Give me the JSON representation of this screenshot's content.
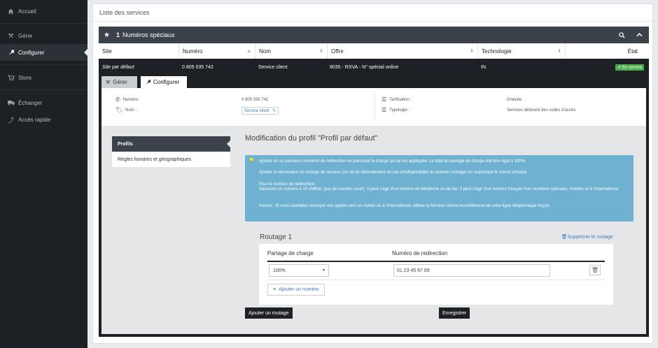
{
  "sidebar": {
    "items": [
      {
        "label": "Accueil",
        "icon": "home-icon"
      },
      {
        "label": "Gérer",
        "icon": "tools-icon"
      },
      {
        "label": "Configurer",
        "icon": "wrench-icon"
      },
      {
        "label": "Store",
        "icon": "cart-icon"
      },
      {
        "label": "Échanger",
        "icon": "truck-icon"
      },
      {
        "label": "Accès rapide",
        "icon": "shortcut-icon"
      }
    ]
  },
  "page": {
    "title": "Liste des services"
  },
  "section": {
    "count": "1",
    "title": "Numéros spéciaux"
  },
  "table": {
    "headers": [
      "Site",
      "Numéro",
      "Nom",
      "Offre",
      "Technologie",
      "État"
    ],
    "row": {
      "site": "Site par défaut",
      "numero": "0 805 035 742",
      "nom": "Service client",
      "offre": "8035 - RSVA - N° spécial online",
      "technologie": "IN",
      "etat": "En service"
    }
  },
  "tabs": {
    "manage": "Gérer",
    "configure": "Configurer"
  },
  "details": {
    "numero_label": "Numéro :",
    "numero_value": "0 805 035 742",
    "nom_label": "Nom :",
    "nom_value": "Service client",
    "tarification_label": "Tarification :",
    "tarification_value": "Gratuite",
    "typologie_label": "Typologie :",
    "typologie_value": "Services délivrant des codes d'accès"
  },
  "profiles_menu": {
    "items": [
      "Profils",
      "Règles horaires et géographiques"
    ]
  },
  "profile": {
    "title": "Modification du profil \"Profil par défaut\"",
    "alert": [
      "Ajouter un ou plusieurs numéros de redirection en précisant la charge qui lui est appliquée. Le total du partage de charge doit être égal à 100%.",
      "Ajouter si nécessaire un routage de secours (ou dit de débordement en cas d'indisponibilité du premier routage) en respectant le même principe.",
      "Pour le numéro de redirection :\nSaisissez un numéro à 10 chiffres (pas de numéro court). Il peut s'agir d'un numéro de téléphone ou de fax. Il peut s'agir d'un numéro français hors numéros spéciaux, mobiles et à l'international.",
      "Astuce : Si vous souhaitez renvoyer vos appels vers un mobile ou à l'international, utiliser la fonction renvoi inconditionnel de votre ligne téléphonique Keyyo."
    ]
  },
  "routing": {
    "title": "Routage 1",
    "delete_label": "Supprimer le routage",
    "col_charge": "Partage de charge",
    "col_number": "Numéro de redirection",
    "charge_value": "100%",
    "number_value": "01 23 45 67 89",
    "add_number_label": "Ajouter un numéro"
  },
  "actions": {
    "add_routing": "Ajouter un routage",
    "save": "Enregistrer"
  },
  "colors": {
    "sidebar": "#1d2126",
    "header": "#3c4249",
    "alert": "#6fb1d1",
    "success": "#4cae4c",
    "link": "#3c7bbf"
  }
}
